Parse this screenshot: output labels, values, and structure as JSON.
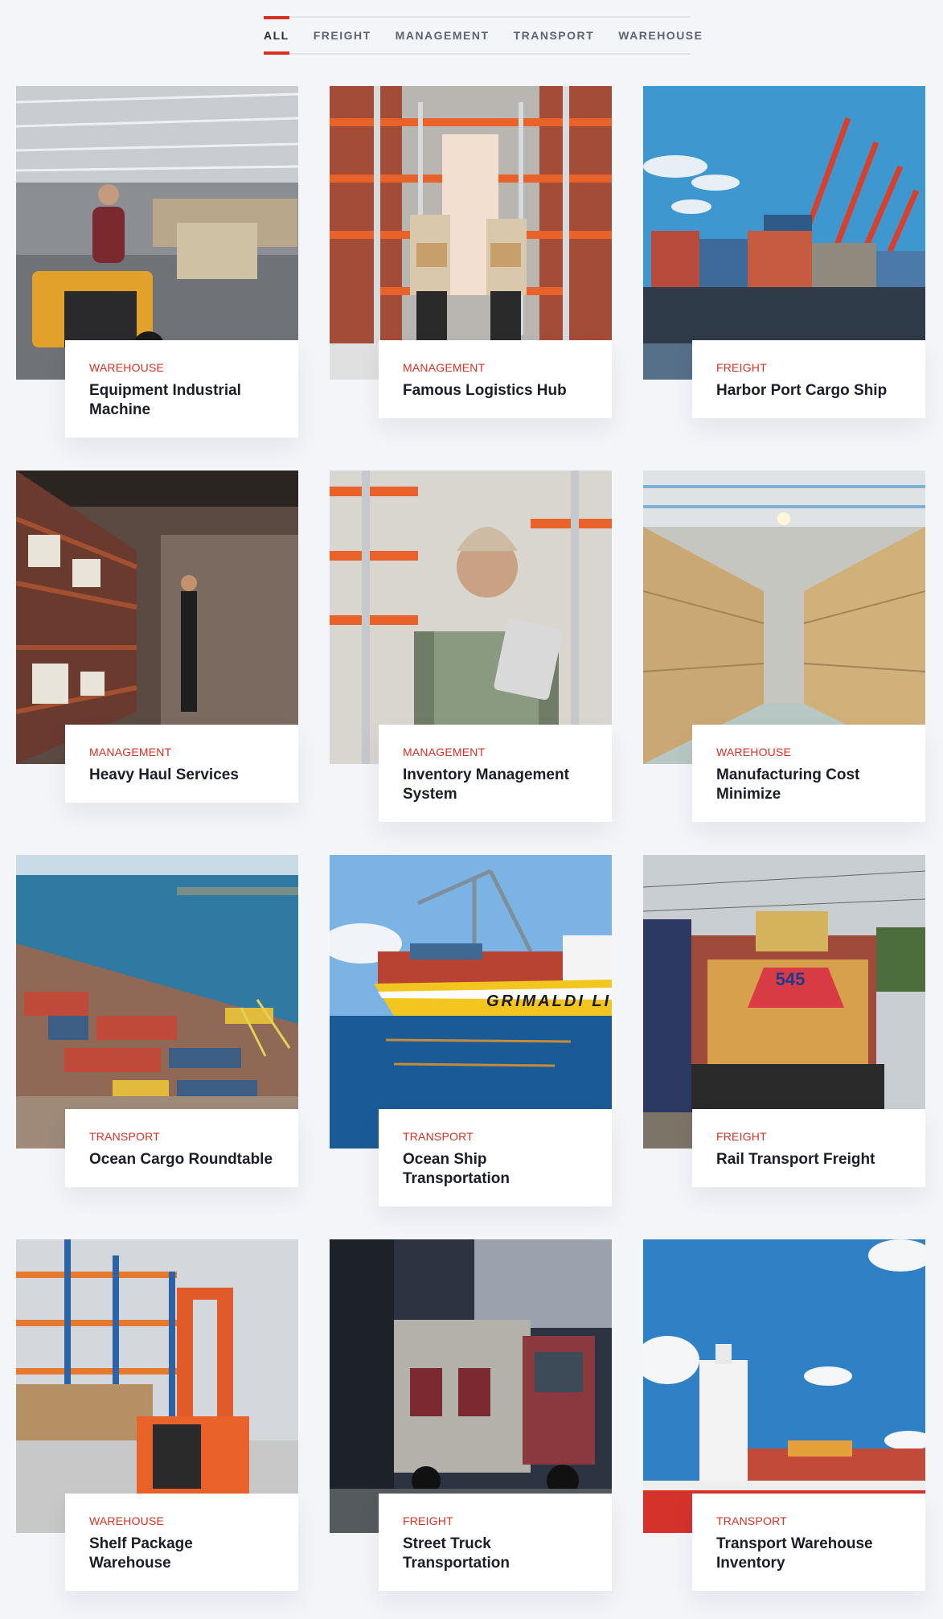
{
  "filters": {
    "all": "ALL",
    "freight": "FREIGHT",
    "management": "MANAGEMENT",
    "transport": "TRANSPORT",
    "warehouse": "WAREHOUSE",
    "active": "ALL"
  },
  "accent_color": "#d8301f",
  "projects": [
    {
      "category": "WAREHOUSE",
      "title": "Equipment Industrial Machine",
      "image_icon": "warehouse-forklift-photo"
    },
    {
      "category": "MANAGEMENT",
      "title": "Famous Logistics Hub",
      "image_icon": "warehouse-workers-photo"
    },
    {
      "category": "FREIGHT",
      "title": "Harbor Port Cargo Ship",
      "image_icon": "cargo-ship-cranes-photo"
    },
    {
      "category": "MANAGEMENT",
      "title": "Heavy Haul Services",
      "image_icon": "warehouse-shelves-photo"
    },
    {
      "category": "MANAGEMENT",
      "title": "Inventory Management System",
      "image_icon": "worker-tablet-photo"
    },
    {
      "category": "WAREHOUSE",
      "title": "Manufacturing Cost Minimize",
      "image_icon": "boxes-aisle-photo"
    },
    {
      "category": "TRANSPORT",
      "title": "Ocean Cargo Roundtable",
      "image_icon": "container-port-photo"
    },
    {
      "category": "TRANSPORT",
      "title": "Ocean Ship Transportation",
      "image_icon": "ship-grimaldi-photo",
      "ship_text": "GRIMALDI LI"
    },
    {
      "category": "FREIGHT",
      "title": "Rail Transport Freight",
      "image_icon": "locomotive-photo",
      "loco_number": "545"
    },
    {
      "category": "WAREHOUSE",
      "title": "Shelf Package Warehouse",
      "image_icon": "orange-forklift-photo"
    },
    {
      "category": "FREIGHT",
      "title": "Street Truck Transportation",
      "image_icon": "truck-photo"
    },
    {
      "category": "TRANSPORT",
      "title": "Transport Warehouse Inventory",
      "image_icon": "cargo-vessel-sky-photo"
    }
  ]
}
